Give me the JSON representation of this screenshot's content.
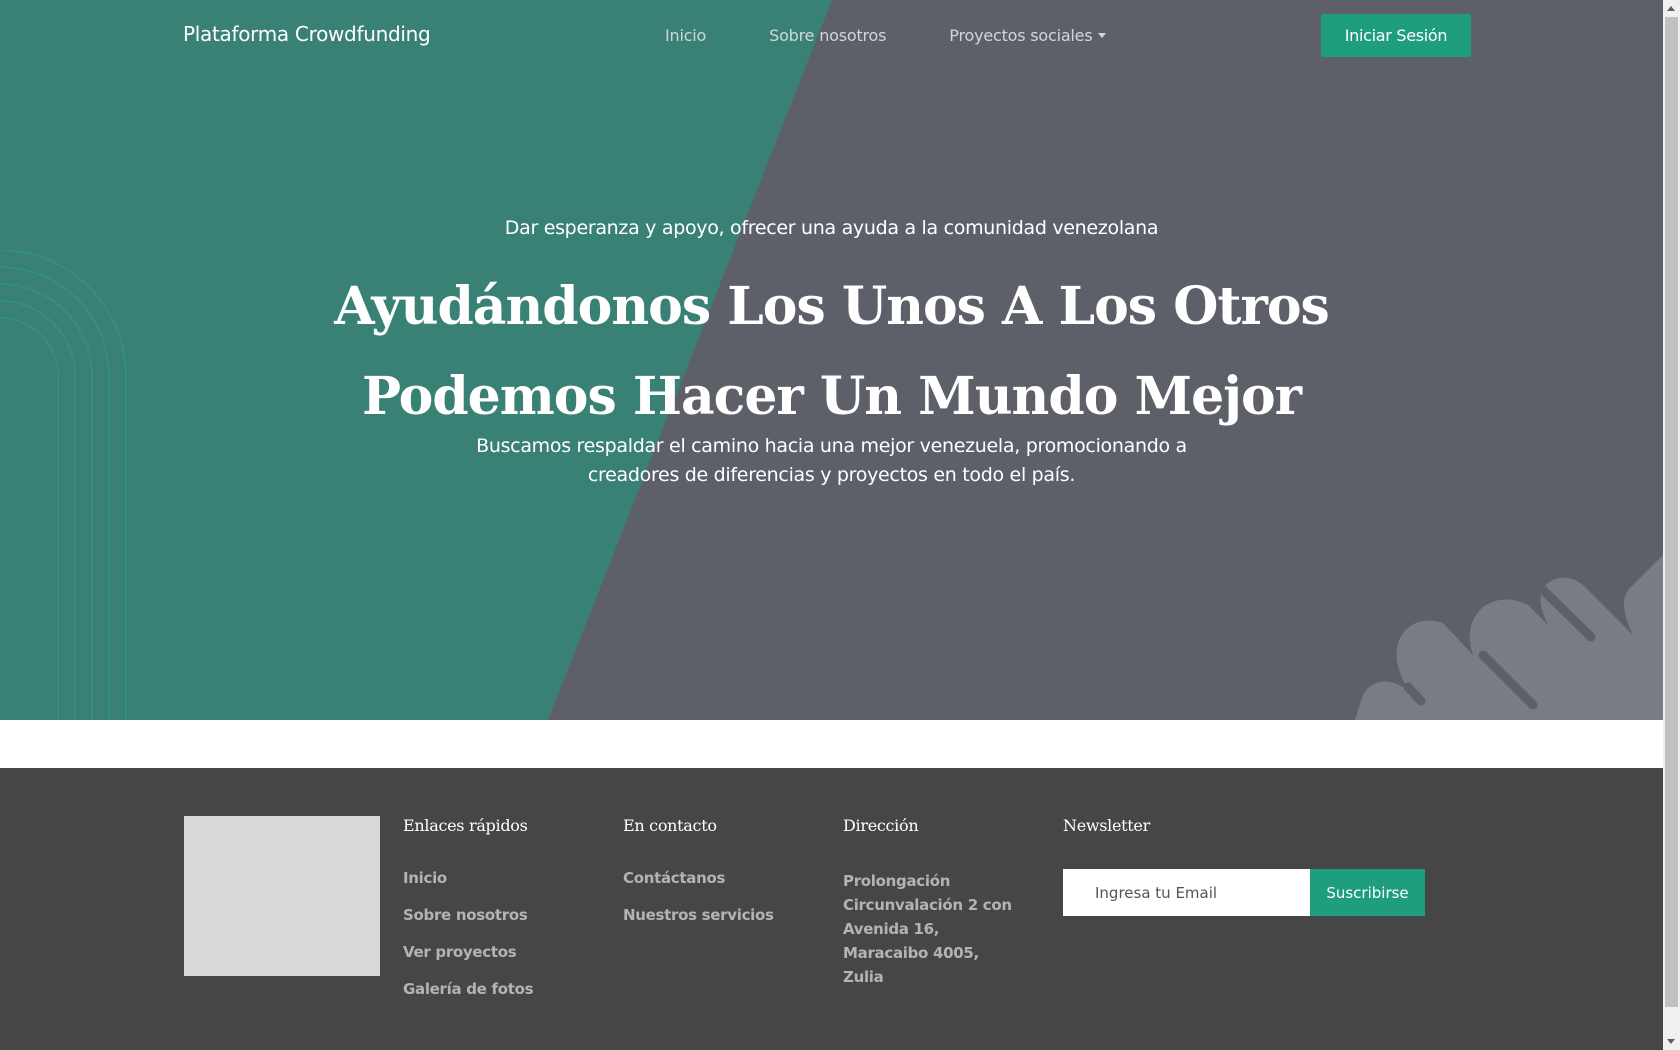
{
  "nav": {
    "brand": "Plataforma Crowdfunding",
    "links": [
      "Inicio",
      "Sobre nosotros",
      "Proyectos sociales"
    ],
    "login_label": "Iniciar Sesión"
  },
  "hero": {
    "tagline": "Dar esperanza y apoyo, ofrecer una ayuda a la comunidad venezolana",
    "headline_line1": "Ayudándonos Los Unos A Los Otros",
    "headline_line2": "Podemos Hacer Un Mundo Mejor",
    "lead": "Buscamos respaldar el camino hacia una mejor venezuela, promocionando a creadores de diferencias y proyectos en todo el país."
  },
  "footer": {
    "quick_links": {
      "title": "Enlaces rápidos",
      "items": [
        "Inicio",
        "Sobre nosotros",
        "Ver proyectos",
        "Galería de fotos"
      ]
    },
    "contact": {
      "title": "En contacto",
      "items": [
        "Contáctanos",
        "Nuestros servicios"
      ]
    },
    "address": {
      "title": "Dirección",
      "text": "Prolongación Circunvalación 2 con Avenida 16, Maracaibo 4005, Zulia"
    },
    "newsletter": {
      "title": "Newsletter",
      "placeholder": "Ingresa tu Email",
      "button": "Suscribirse"
    }
  },
  "colors": {
    "hero_green": "#3a8175",
    "hero_gray": "#5d6068",
    "accent": "#1f9e7d",
    "footer_bg": "#464646"
  }
}
